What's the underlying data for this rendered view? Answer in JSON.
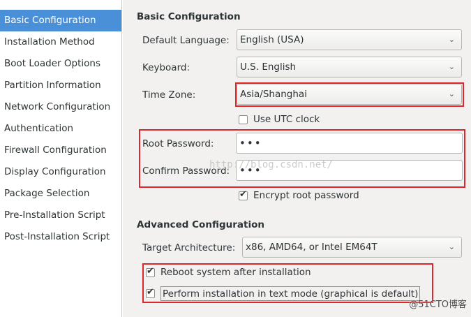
{
  "sidebar": {
    "items": [
      {
        "label": "Basic Configuration"
      },
      {
        "label": "Installation Method"
      },
      {
        "label": "Boot Loader Options"
      },
      {
        "label": "Partition Information"
      },
      {
        "label": "Network Configuration"
      },
      {
        "label": "Authentication"
      },
      {
        "label": "Firewall Configuration"
      },
      {
        "label": "Display Configuration"
      },
      {
        "label": "Package Selection"
      },
      {
        "label": "Pre-Installation Script"
      },
      {
        "label": "Post-Installation Script"
      }
    ],
    "selected_index": 0
  },
  "basic": {
    "title": "Basic Configuration",
    "default_language_label": "Default Language:",
    "default_language_value": "English (USA)",
    "keyboard_label": "Keyboard:",
    "keyboard_value": "U.S. English",
    "time_zone_label": "Time Zone:",
    "time_zone_value": "Asia/Shanghai",
    "utc_clock_label": "Use UTC clock",
    "utc_clock_checked": false,
    "root_password_label": "Root Password:",
    "root_password_value": "•••",
    "confirm_password_label": "Confirm Password:",
    "confirm_password_value": "•••",
    "encrypt_label": "Encrypt root password",
    "encrypt_checked": true
  },
  "advanced": {
    "title": "Advanced Configuration",
    "target_arch_label": "Target Architecture:",
    "target_arch_value": "x86, AMD64, or Intel EM64T",
    "reboot_label": "Reboot system after installation",
    "reboot_checked": true,
    "text_mode_label": "Perform installation in text mode (graphical is default)",
    "text_mode_checked": true
  },
  "overlay": {
    "watermark_text": "http://blog.csdn.net/",
    "logo_text": "@51CTO博客",
    "highlight_color": "#e0262d"
  }
}
